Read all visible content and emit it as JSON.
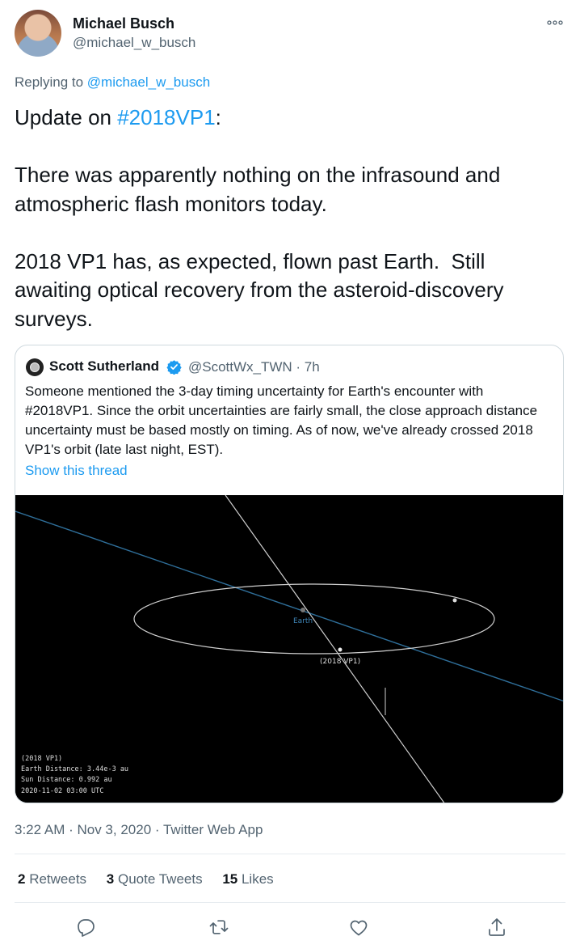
{
  "author": {
    "name": "Michael Busch",
    "handle": "@michael_w_busch"
  },
  "more_icon": "more-dots-icon",
  "replying": {
    "prefix": "Replying to ",
    "handle": "@michael_w_busch"
  },
  "tweet": {
    "part1": "Update on ",
    "hashtag": "#2018VP1",
    "part2": ":\n\nThere was apparently nothing on the infrasound and atmospheric flash monitors today.\n\n2018 VP1 has, as expected, flown past Earth.  Still awaiting optical recovery from the asteroid-discovery surveys."
  },
  "quote": {
    "name": "Scott Sutherland",
    "handle": "@ScottWx_TWN · 7h",
    "text": "Someone mentioned the 3-day timing uncertainty for Earth's encounter with #2018VP1. Since the orbit uncertainties are fairly small, the close approach distance uncertainty must be based mostly on timing. As of now, we've already crossed 2018 VP1's orbit (late last night, EST).",
    "show_thread": "Show this thread",
    "media": {
      "earth_label": "Earth",
      "object_label": "(2018 VP1)",
      "info_lines": [
        "(2018 VP1)",
        "Earth Distance: 3.44e-3 au",
        "Sun Distance: 0.992 au",
        "2020-11-02 03:00 UTC"
      ],
      "colors": {
        "background": "#000000",
        "earth_orbit": "#2f6f9a",
        "object_orbit": "#cfcfcf"
      }
    }
  },
  "meta": "3:22 AM · Nov 3, 2020 · Twitter Web App",
  "stats": {
    "retweets_count": "2",
    "retweets_label": " Retweets",
    "quotes_count": "3",
    "quotes_label": " Quote Tweets",
    "likes_count": "15",
    "likes_label": " Likes"
  },
  "actions": [
    "reply-icon",
    "retweet-icon",
    "like-icon",
    "share-icon"
  ],
  "colors": {
    "accent": "#1d9bf0",
    "secondary_text": "#536471",
    "border": "#cfd9de"
  }
}
